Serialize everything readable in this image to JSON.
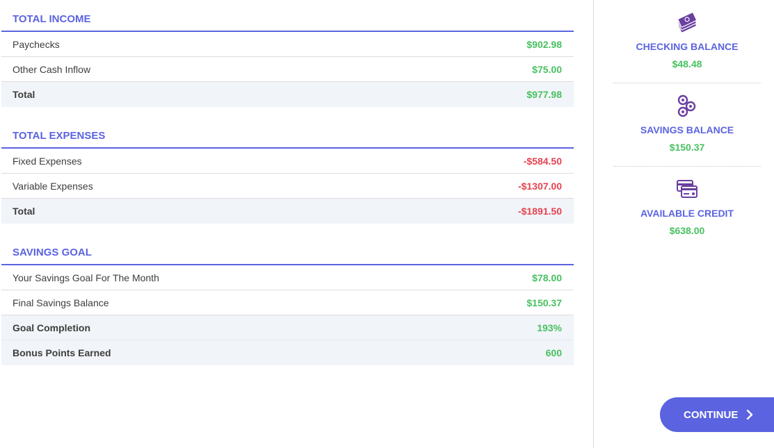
{
  "income": {
    "title": "TOTAL INCOME",
    "rows": [
      {
        "label": "Paychecks",
        "value": "$902.98"
      },
      {
        "label": "Other Cash Inflow",
        "value": "$75.00"
      }
    ],
    "total": {
      "label": "Total",
      "value": "$977.98"
    }
  },
  "expenses": {
    "title": "TOTAL EXPENSES",
    "rows": [
      {
        "label": "Fixed Expenses",
        "value": "-$584.50"
      },
      {
        "label": "Variable Expenses",
        "value": "-$1307.00"
      }
    ],
    "total": {
      "label": "Total",
      "value": "-$1891.50"
    }
  },
  "savings": {
    "title": "SAVINGS GOAL",
    "rows": [
      {
        "label": "Your Savings Goal For The Month",
        "value": "$78.00"
      },
      {
        "label": "Final Savings Balance",
        "value": "$150.37"
      }
    ],
    "completion": {
      "label": "Goal Completion",
      "value": "193%"
    },
    "bonus": {
      "label": "Bonus Points Earned",
      "value": "600"
    }
  },
  "sidebar": {
    "checking": {
      "label": "CHECKING BALANCE",
      "amount": "$48.48",
      "icon": "money-stack-icon"
    },
    "savings": {
      "label": "SAVINGS BALANCE",
      "amount": "$150.37",
      "icon": "coins-icon"
    },
    "credit": {
      "label": "AVAILABLE CREDIT",
      "amount": "$638.00",
      "icon": "credit-card-icon"
    }
  },
  "continue_label": "CONTINUE",
  "colors": {
    "accent": "#5b63e0",
    "positive": "#47c160",
    "negative": "#e5424f",
    "icon": "#6b3fa0"
  }
}
